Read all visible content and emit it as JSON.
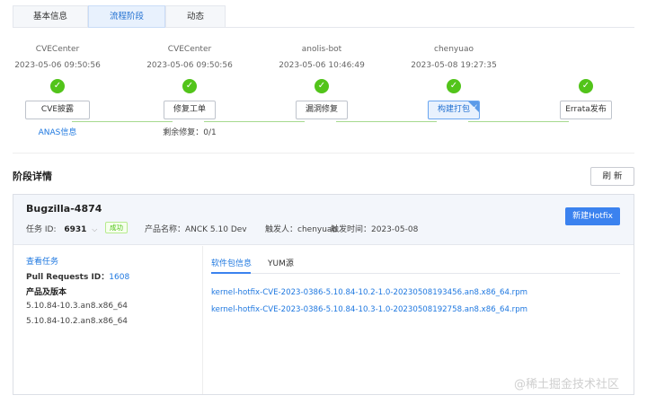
{
  "tabs": [
    {
      "label": "基本信息",
      "active": false
    },
    {
      "label": "流程阶段",
      "active": true
    },
    {
      "label": "动态",
      "active": false
    }
  ],
  "timeline": {
    "steps": [
      {
        "user": "CVECenter",
        "time": "2023-05-06 09:50:56",
        "button": "CVE披露",
        "sub": "ANAS信息",
        "selected": false
      },
      {
        "user": "CVECenter",
        "time": "2023-05-06 09:50:56",
        "button": "修复工单",
        "sub": "剩余修复：0/1",
        "selected": false
      },
      {
        "user": "anolis-bot",
        "time": "2023-05-06 10:46:49",
        "button": "漏洞修复",
        "sub": "",
        "selected": false
      },
      {
        "user": "chenyuao",
        "time": "2023-05-08 19:27:35",
        "button": "构建打包",
        "sub": "",
        "selected": true
      },
      {
        "user": "",
        "time": "",
        "button": "Errata发布",
        "sub": "",
        "selected": false
      }
    ],
    "status_color": "#52c41a"
  },
  "section": {
    "title": "阶段详情",
    "refresh_label": "刷 新"
  },
  "card": {
    "title": "Bugzilla-4874",
    "task_label": "任务 ID:",
    "task_id": "6931",
    "badge": "成功",
    "product": "产品名称：ANCK 5.10 Dev",
    "trigger": "触发人：chenyuao",
    "trigger_time": "触发时间：2023-05-08",
    "new_button": "新建Hotfix"
  },
  "left": {
    "view_task": "查看任务",
    "pr_label": "Pull Requests ID：",
    "pr_id": "1608",
    "versions_header": "产品及版本",
    "versions": [
      "5.10.84-10.3.an8.x86_64",
      "5.10.84-10.2.an8.x86_64"
    ]
  },
  "subtabs": [
    {
      "label": "软件包信息",
      "active": true
    },
    {
      "label": "YUM源",
      "active": false
    }
  ],
  "packages": [
    "kernel-hotfix-CVE-2023-0386-5.10.84-10.2-1.0-20230508193456.an8.x86_64.rpm",
    "kernel-hotfix-CVE-2023-0386-5.10.84-10.3-1.0-20230508192758.an8.x86_64.rpm"
  ],
  "watermark": "@稀土掘金技术社区",
  "colors": {
    "accent": "#3b82ef",
    "link": "#1f78e0",
    "success": "#52c41a"
  }
}
